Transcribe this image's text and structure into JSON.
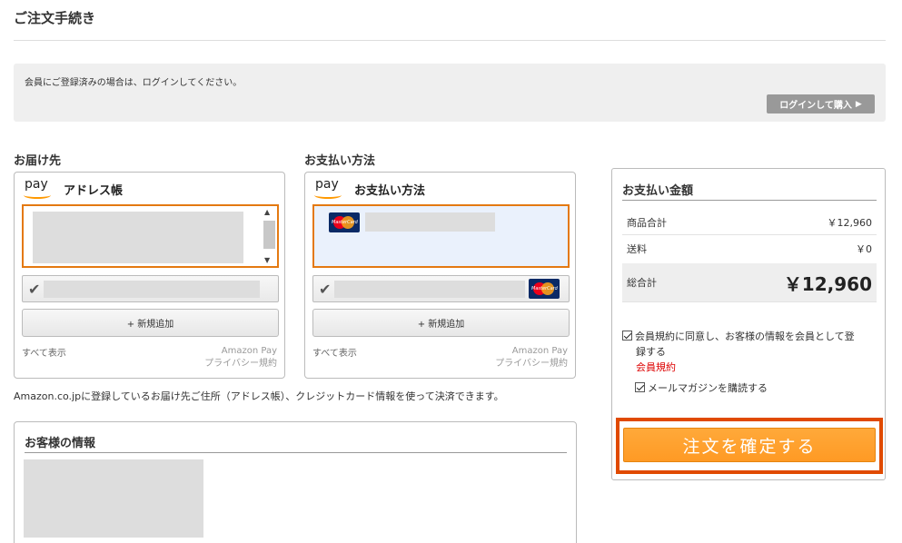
{
  "page": {
    "title": "ご注文手続き"
  },
  "login": {
    "message": "会員にご登録済みの場合は、ログインしてください。",
    "button_label": "ログインして購入",
    "button_arrow": "▶"
  },
  "shipping": {
    "section_label": "お届け先",
    "logo_text": "pay",
    "widget_title": "アドレス帳",
    "add_new_label": "+ 新規追加",
    "show_all_label": "すべて表示",
    "amazon_pay_label": "Amazon Pay",
    "privacy_label": "プライバシー規約"
  },
  "payment": {
    "section_label": "お支払い方法",
    "logo_text": "pay",
    "widget_title": "お支払い方法",
    "add_new_label": "+ 新規追加",
    "show_all_label": "すべて表示",
    "amazon_pay_label": "Amazon Pay",
    "privacy_label": "プライバシー規約"
  },
  "note": "Amazon.co.jpに登録しているお届け先ご住所（アドレス帳）、クレジットカード情報を使って決済できます。",
  "customer": {
    "title": "お客様の情報"
  },
  "summary": {
    "title": "お支払い金額",
    "subtotal_label": "商品合計",
    "subtotal_value": "￥12,960",
    "shipping_label": "送料",
    "shipping_value": "￥0",
    "total_label": "総合計",
    "total_value": "￥12,960",
    "agree_line1": "会員規約に同意し、お客様の情報を会員として登",
    "agree_line2": "録する",
    "terms_link": "会員規約",
    "mail_label": "メールマガジンを購読する",
    "confirm_label": "注文を確定する"
  },
  "icons": {
    "card_brand": "mastercard-icon",
    "card_brand_text": "MasterCard",
    "check_mark": "✔",
    "scroll_up": "▲",
    "scroll_down": "▼"
  },
  "colors": {
    "accent_orange": "#e47911",
    "confirm_button": "#ff9a24",
    "confirm_highlight": "#e04a00",
    "link_red": "#dd0000"
  }
}
